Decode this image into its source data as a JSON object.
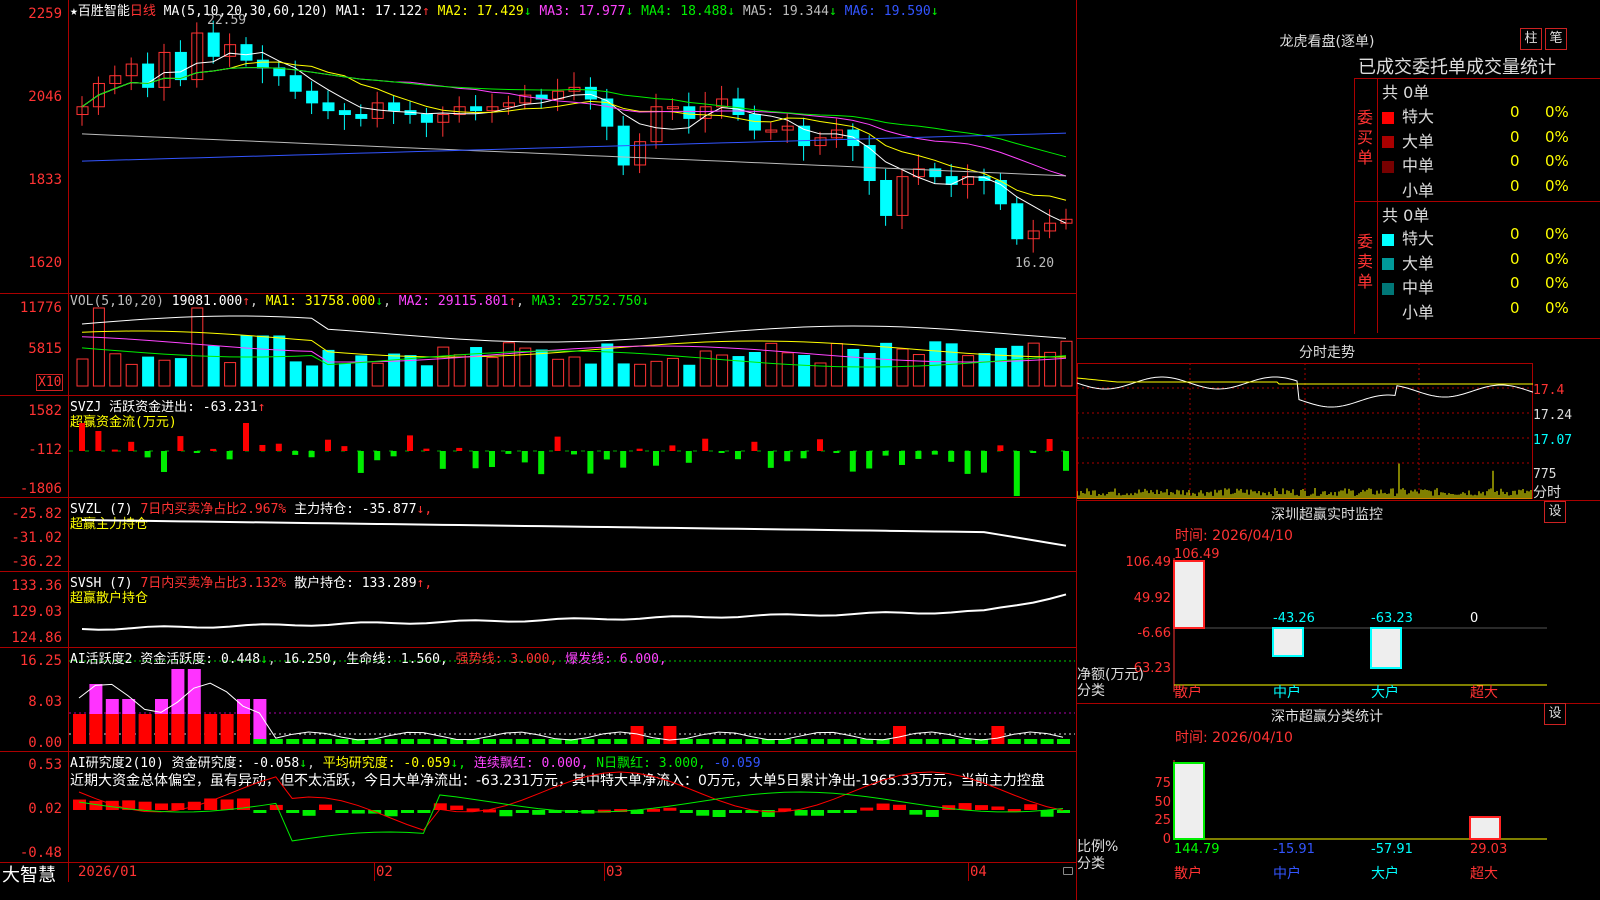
{
  "stock": {
    "title": "★百胜智能",
    "period": "日线",
    "ma_label": "MA(5,10,20,30,60,120)",
    "ma": [
      {
        "name": "MA1:",
        "value": "17.122",
        "arrow": "↑",
        "color": "#ffffff"
      },
      {
        "name": "MA2:",
        "value": "17.429",
        "arrow": "↓",
        "color": "#ffff00"
      },
      {
        "name": "MA3:",
        "value": "17.977",
        "arrow": "↓",
        "color": "#ff44ff"
      },
      {
        "name": "MA4:",
        "value": "18.488",
        "arrow": "↓",
        "color": "#00ee00"
      },
      {
        "name": "MA5:",
        "value": "19.344",
        "arrow": "↓",
        "color": "#bbbbbb"
      },
      {
        "name": "MA6:",
        "value": "19.590",
        "arrow": "↓",
        "color": "#3355ff"
      }
    ],
    "price_axis": [
      "2259",
      "2046",
      "1833",
      "1620"
    ],
    "high_label": "22.59",
    "low_label": "16.20"
  },
  "vol": {
    "label": "VOL(5,10,20)",
    "value": "19081.000",
    "ma1": "MA1: 31758.000",
    "ma1_arrow": "↓",
    "ma2": "MA2: 29115.801",
    "ma2_arrow": "↑",
    "ma3": "MA3: 25752.750",
    "ma3_arrow": "↓",
    "axis": [
      "11776",
      "5815"
    ],
    "unit": "X10"
  },
  "svzj": {
    "label": "SVZJ  活跃资金进出: -63.231",
    "arrow": "↑",
    "sub": "超赢资金流(万元)",
    "axis": [
      "1582",
      "-112",
      "-1806"
    ]
  },
  "svzl": {
    "label_a": "SVZL (7)",
    "label_b": "7日内买卖净占比2.967%",
    "label_c": "主力持仓: -35.877",
    "arrow": "↓,",
    "sub": "超赢主力持仓",
    "axis": [
      "-25.82",
      "-31.02",
      "-36.22"
    ]
  },
  "svsh": {
    "label_a": "SVSH (7)",
    "label_b": "7日内买卖净占比3.132%",
    "label_c": "散户持仓: 133.289",
    "arrow": "↑,",
    "sub": "超赢散户持仓",
    "axis": [
      "133.36",
      "129.03",
      "124.86"
    ]
  },
  "ai_active": {
    "label": "AI活跃度2 资金活跃度: 0.448",
    "arrow1": "↓",
    "v2": "16.250,",
    "v3": "生命线: 1.560,",
    "v4": "强势线: 3.000,",
    "v5": "爆发线: 6.000,",
    "axis": [
      "16.25",
      "8.03",
      "0.00"
    ]
  },
  "ai_research": {
    "label": "AI研究度2(10) 资金研究度: -0.058",
    "arrow1": "↓",
    "avg": "平均研究度: -0.059",
    "arrow2": "↓,",
    "red1": "连续飘红: 0.000,",
    "red2": "N日飘红: 3.000,",
    "last": "-0.059",
    "axis": [
      "0.53",
      "0.02",
      "-0.48"
    ],
    "comment": "近期大资金总体偏空，虽有异动，但不太活跃，今日大单净流出：-63.231万元，其中特大单净流入：0万元，大单5日累计净出-1965.33万元，当前主力控盘"
  },
  "date_axis": [
    "2026/01",
    "02",
    "03",
    "04"
  ],
  "brand": "大智慧",
  "dragon": {
    "title": "龙虎看盘(逐单)",
    "btn_col": "柱",
    "btn_pen": "笔",
    "header": "已成交委托单成交量统计",
    "buy_label": "委买单",
    "sell_label": "委卖单",
    "buy_total": "共 0单",
    "sell_total": "共 0单",
    "buy_rows": [
      {
        "name": "特大",
        "count": "0",
        "pct": "0%",
        "color": "#ff0000"
      },
      {
        "name": "大单",
        "count": "0",
        "pct": "0%",
        "color": "#aa0000"
      },
      {
        "name": "中单",
        "count": "0",
        "pct": "0%",
        "color": "#770000"
      },
      {
        "name": "小单",
        "count": "0",
        "pct": "0%",
        "color": "#000000"
      }
    ],
    "sell_rows": [
      {
        "name": "特大",
        "count": "0",
        "pct": "0%",
        "color": "#00ffff"
      },
      {
        "name": "大单",
        "count": "0",
        "pct": "0%",
        "color": "#009999"
      },
      {
        "name": "中单",
        "count": "0",
        "pct": "0%",
        "color": "#007777"
      },
      {
        "name": "小单",
        "count": "0",
        "pct": "0%",
        "color": "#000000"
      }
    ]
  },
  "intraday": {
    "title": "分时走势",
    "axis": [
      "17.4",
      "17.24",
      "17.07"
    ],
    "vol": "775",
    "vol_label": "分时"
  },
  "sz_monitor": {
    "title": "深圳超赢实时监控",
    "btn": "设",
    "time": "时间: 2026/04/10",
    "axis": [
      "106.49",
      "49.92",
      "-6.66",
      "-63.23"
    ],
    "y_title": "净额(万元)",
    "x_title": "分类",
    "cats": [
      "散户",
      "中户",
      "大户",
      "超大"
    ],
    "values": [
      "106.49",
      "-43.26",
      "-63.23",
      "0"
    ]
  },
  "sz_class": {
    "title": "深市超赢分类统计",
    "btn": "设",
    "time": "时间: 2026/04/10",
    "axis": [
      "75",
      "50",
      "25",
      "0"
    ],
    "y_title": "比例%",
    "x_title": "分类",
    "cats": [
      "散户",
      "中户",
      "大户",
      "超大"
    ],
    "values": [
      "144.79",
      "-15.91",
      "-57.91",
      "29.03"
    ]
  }
}
